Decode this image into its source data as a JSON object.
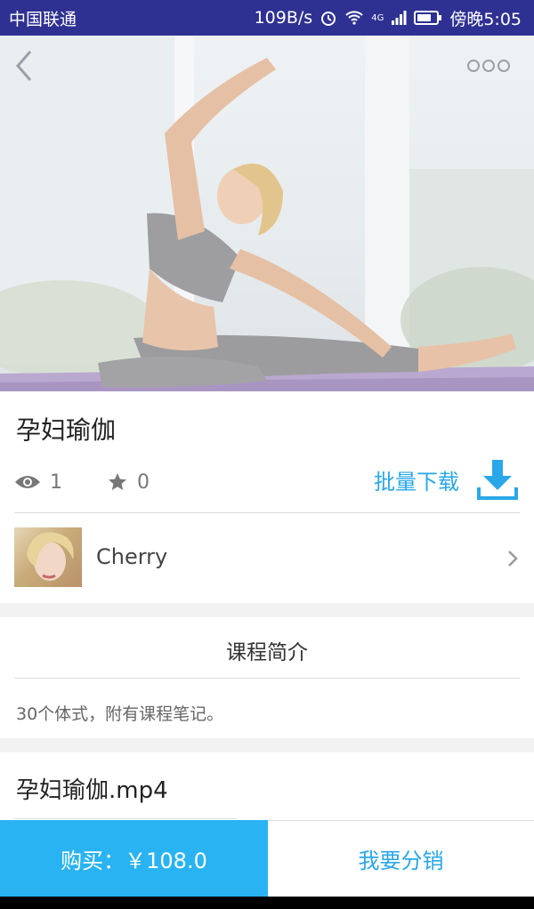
{
  "status_bar": {
    "carrier": "中国联通",
    "speed": "109B/s",
    "network": "4G",
    "time": "傍晚5:05"
  },
  "course": {
    "title": "孕妇瑜伽",
    "views": "1",
    "stars": "0",
    "batch_download_label": "批量下载"
  },
  "author": {
    "name": "Cherry"
  },
  "intro": {
    "heading": "课程简介",
    "description": "30个体式，附有课程笔记。"
  },
  "file": {
    "name": "孕妇瑜伽.mp4"
  },
  "bottom": {
    "buy_label": "购买：￥108.0",
    "distribute_label": "我要分销"
  },
  "colors": {
    "status_bar": "#2e3192",
    "accent": "#29a7e8",
    "buy_button": "#29b3f2"
  }
}
